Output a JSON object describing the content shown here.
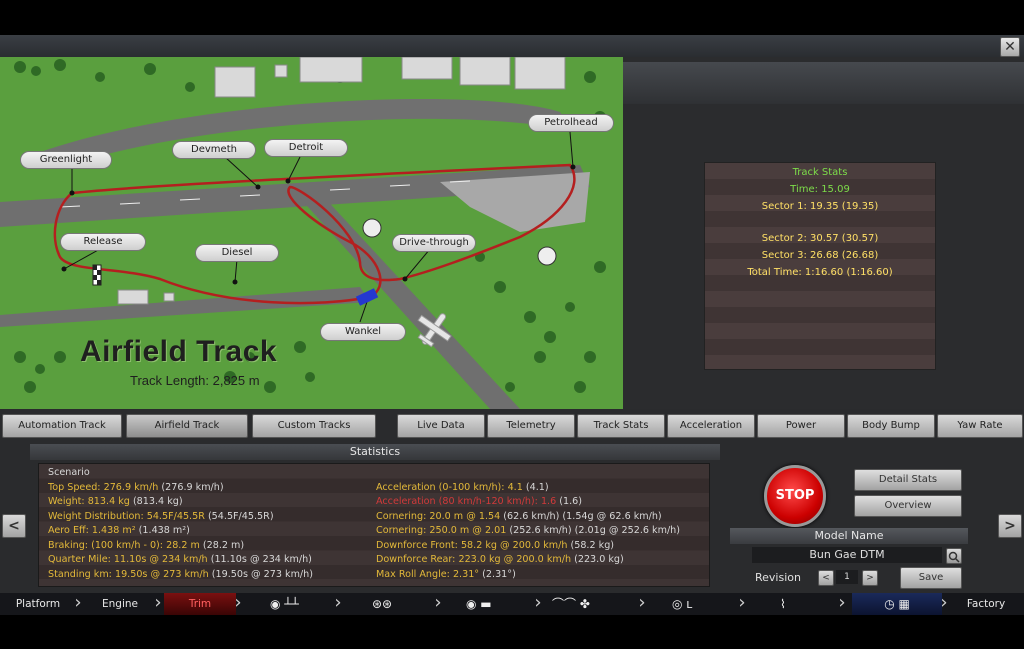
{
  "window": {
    "close_label": "✕"
  },
  "map": {
    "title": "Airfield Track",
    "length": "Track Length: 2,825 m",
    "labels": {
      "greenlight": "Greenlight",
      "devmeth": "Devmeth",
      "detroit": "Detroit",
      "petrolhead": "Petrolhead",
      "release": "Release",
      "diesel": "Diesel",
      "drive_through": "Drive-through",
      "wankel": "Wankel"
    }
  },
  "track_stats": {
    "heading": "Track Stats",
    "time": "Time: 15.09",
    "sector1": "Sector 1: 19.35 (19.35)",
    "sector2": "Sector 2: 30.57 (30.57)",
    "sector3": "Sector 3: 26.68 (26.68)",
    "total": "Total Time: 1:16.60 (1:16.60)",
    "colors": {
      "heading": "#7ddc4a",
      "value": "#ffe066"
    }
  },
  "track_tabs": [
    "Automation Track",
    "Airfield Track",
    "Custom Tracks"
  ],
  "data_tabs": [
    "Live Data",
    "Telemetry",
    "Track Stats",
    "Acceleration",
    "Power",
    "Body Bump",
    "Yaw Rate"
  ],
  "statistics": {
    "heading": "Statistics",
    "scenario": "Scenario",
    "left": [
      {
        "label": "Top Speed: 276.9 km/h",
        "value": "(276.9 km/h)"
      },
      {
        "label": "Weight: 813.4 kg",
        "value": "(813.4 kg)"
      },
      {
        "label": "Weight Distribution: 54.5F/45.5R",
        "value": "(54.5F/45.5R)"
      },
      {
        "label": "Aero Eff: 1.438 m²",
        "value": "(1.438 m²)"
      },
      {
        "label": "Braking: (100 km/h - 0): 28.2 m",
        "value": "(28.2 m)"
      },
      {
        "label": "Quarter Mile: 11.10s @ 234 km/h",
        "value": "(11.10s @ 234 km/h)"
      },
      {
        "label": "Standing km: 19.50s @ 273 km/h",
        "value": "(19.50s @ 273 km/h)"
      }
    ],
    "right": [
      {
        "label": "Acceleration (0-100 km/h): 4.1",
        "value": "(4.1)",
        "highlight": false
      },
      {
        "label": "Acceleration (80 km/h-120 km/h): 1.6",
        "value": "(1.6)",
        "highlight": true
      },
      {
        "label": "Cornering: 20.0 m @ 1.54",
        "value": "(62.6 km/h) (1.54g @ 62.6 km/h)",
        "highlight": false
      },
      {
        "label": "Cornering: 250.0 m @ 2.01",
        "value": "(252.6 km/h) (2.01g @ 252.6 km/h)",
        "highlight": false
      },
      {
        "label": "Downforce Front: 58.2 kg @ 200.0 km/h",
        "value": "(58.2 kg)",
        "highlight": false
      },
      {
        "label": "Downforce Rear: 223.0 kg @ 200.0 km/h",
        "value": "(223.0 kg)",
        "highlight": false
      },
      {
        "label": "Max Roll Angle: 2.31°",
        "value": "(2.31°)",
        "highlight": false
      }
    ]
  },
  "controls": {
    "stop": "STOP",
    "detail_stats": "Detail Stats",
    "overview": "Overview",
    "model_name_heading": "Model Name",
    "model_name": "Bun Gae DTM",
    "revision_label": "Revision",
    "revision_value": "1",
    "save": "Save",
    "prev": "<",
    "next": ">"
  },
  "nav": {
    "left_arrow": "<",
    "right_arrow": ">",
    "items": [
      "Platform",
      "Engine",
      "Trim",
      "Factory"
    ]
  }
}
